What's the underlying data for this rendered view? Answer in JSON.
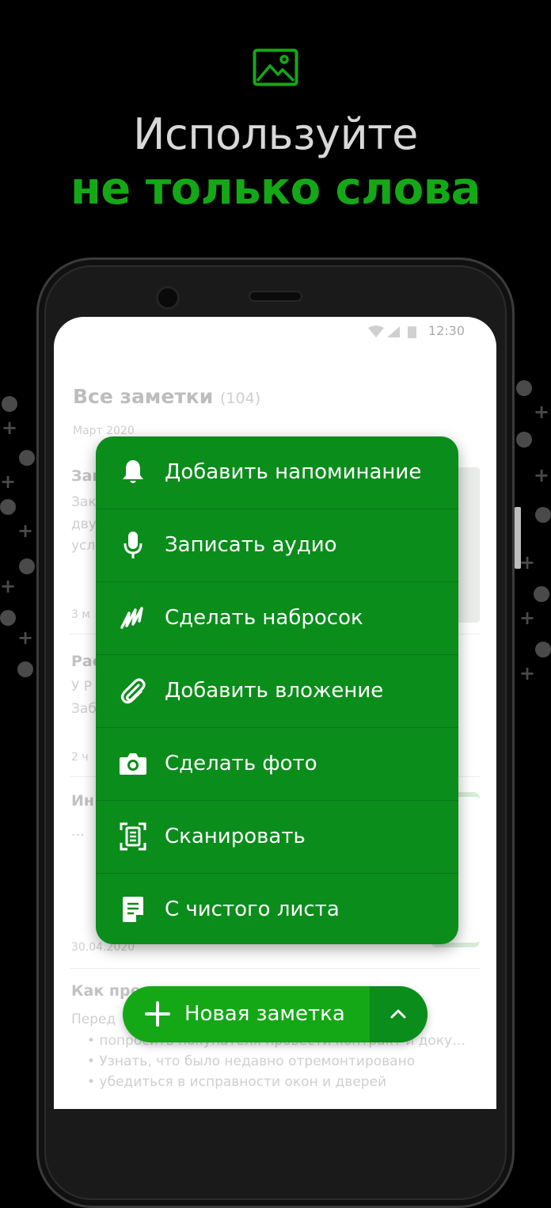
{
  "hero": {
    "line1": "Используйте",
    "line2": "не только слова",
    "icon": "image-icon",
    "accent_color": "#14a817"
  },
  "status_bar": {
    "time": "12:30",
    "icons": [
      "wifi-icon",
      "signal-icon",
      "battery-icon"
    ]
  },
  "notes": {
    "title": "Все заметки",
    "count": "(104)",
    "month": "Март 2020",
    "items": [
      {
        "title": "Зам",
        "snippet1": "Зак",
        "snippet2": "дву",
        "snippet3": "усл",
        "date": "3 м"
      },
      {
        "title": "Рас",
        "snippet1": "У Р",
        "snippet2": "Заб",
        "date": "2 ч"
      },
      {
        "title": "Ин",
        "snippet1": "…",
        "date": "30.04.2020"
      },
      {
        "title": "Как пре",
        "snippet1": "Перед",
        "bullets": [
          "• попросить покупателя провести контракт и доку…",
          "• Узнать, что было недавно отремонтировано",
          "• убедиться в исправности окон и дверей"
        ]
      }
    ]
  },
  "menu": {
    "items": [
      {
        "label": "Добавить напоминание",
        "icon": "bell-icon"
      },
      {
        "label": "Записать аудио",
        "icon": "microphone-icon"
      },
      {
        "label": "Сделать набросок",
        "icon": "sketch-icon"
      },
      {
        "label": "Добавить вложение",
        "icon": "paperclip-icon"
      },
      {
        "label": "Сделать фото",
        "icon": "camera-icon"
      },
      {
        "label": "Сканировать",
        "icon": "scan-icon"
      },
      {
        "label": "С чистого листа",
        "icon": "blank-page-icon"
      }
    ]
  },
  "fab": {
    "label": "Новая заметка",
    "icon": "plus-icon",
    "toggle_icon": "chevron-up-icon"
  },
  "colors": {
    "menu_bg": "#0a8d1b",
    "fab_bg": "#14a817",
    "background": "#000000"
  }
}
